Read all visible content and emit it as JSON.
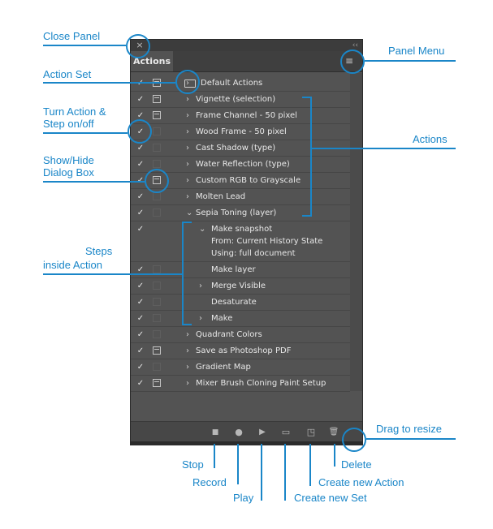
{
  "panel": {
    "tab_label": "Actions",
    "close_glyph": "×",
    "collapse_glyph": "‹‹",
    "menu_glyph": "≡"
  },
  "rows": [
    {
      "check": "✓",
      "dialog": "on",
      "arrow": "›",
      "label": "Default Actions",
      "icon": "folder-icon"
    },
    {
      "check": "✓",
      "dialog": "on",
      "arrow": "›",
      "label": "Vignette (selection)"
    },
    {
      "check": "✓",
      "dialog": "on",
      "arrow": "›",
      "label": "Frame Channel - 50 pixel"
    },
    {
      "check": "✓",
      "dialog": "off",
      "arrow": "›",
      "label": "Wood Frame - 50 pixel"
    },
    {
      "check": "✓",
      "dialog": "off",
      "arrow": "›",
      "label": "Cast Shadow (type)"
    },
    {
      "check": "✓",
      "dialog": "off",
      "arrow": "›",
      "label": "Water Reflection (type)"
    },
    {
      "check": "✓",
      "dialog": "on",
      "arrow": "›",
      "label": "Custom RGB to Grayscale"
    },
    {
      "check": "✓",
      "dialog": "off",
      "arrow": "›",
      "label": "Molten Lead"
    },
    {
      "check": "✓",
      "dialog": "off",
      "arrow": "⌄",
      "label": "Sepia Toning (layer)"
    },
    {
      "check": "✓",
      "dialog": "none",
      "arrow": "⌄",
      "label": "Make snapshot",
      "sub": [
        "From: Current History State",
        "Using: full document"
      ]
    },
    {
      "check": "✓",
      "dialog": "off",
      "arrow": "",
      "label": "Make layer"
    },
    {
      "check": "✓",
      "dialog": "off",
      "arrow": "›",
      "label": "Merge Visible"
    },
    {
      "check": "✓",
      "dialog": "off",
      "arrow": "",
      "label": "Desaturate"
    },
    {
      "check": "✓",
      "dialog": "off",
      "arrow": "›",
      "label": "Make"
    },
    {
      "check": "✓",
      "dialog": "off",
      "arrow": "›",
      "label": "Quadrant Colors"
    },
    {
      "check": "✓",
      "dialog": "on",
      "arrow": "›",
      "label": "Save as Photoshop PDF"
    },
    {
      "check": "✓",
      "dialog": "off",
      "arrow": "›",
      "label": "Gradient Map"
    },
    {
      "check": "✓",
      "dialog": "on",
      "arrow": "›",
      "label": "Mixer Brush Cloning Paint Setup"
    }
  ],
  "footer": {
    "stop_glyph": "■",
    "record_glyph": "●",
    "play_glyph": "▶",
    "new_set_glyph": "▭",
    "new_action_glyph": "◳",
    "delete_glyph": "🗑"
  },
  "annotations": {
    "close_panel": "Close Panel",
    "panel_menu": "Panel Menu",
    "action_set": "Action Set",
    "turn_action_1": "Turn Action &",
    "turn_action_2": "Step on/off",
    "actions": "Actions",
    "show_hide_1": "Show/Hide",
    "show_hide_2": "Dialog Box",
    "steps_1": "Steps",
    "steps_2": "inside Action",
    "drag_resize": "Drag to resize",
    "stop": "Stop",
    "record": "Record",
    "play": "Play",
    "create_set": "Create new Set",
    "create_action": "Create new Action",
    "delete": "Delete"
  },
  "colors": {
    "annotation": "#1a86c8",
    "panel_bg": "#535353"
  }
}
